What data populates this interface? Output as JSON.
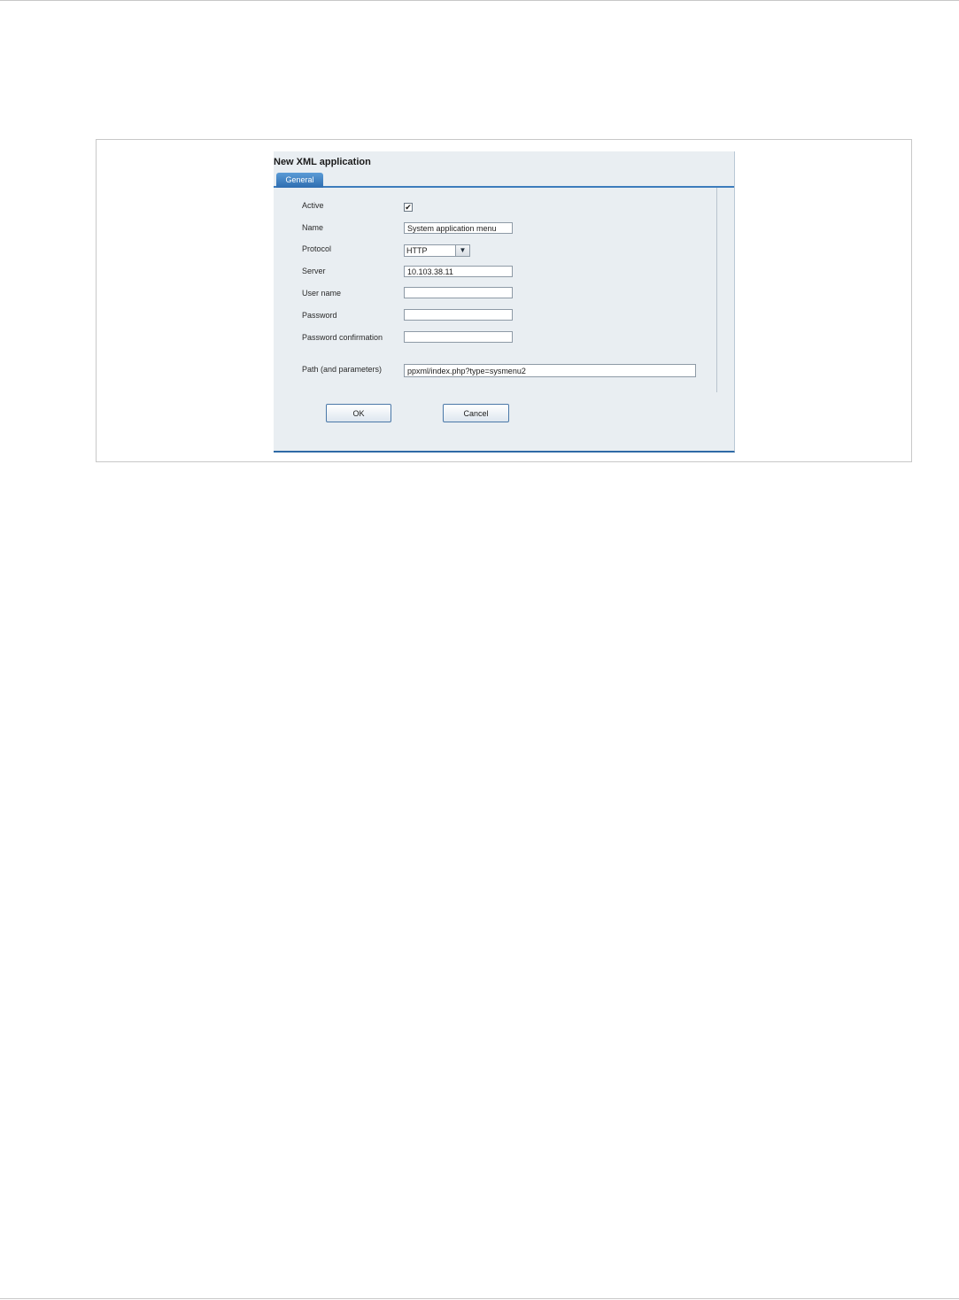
{
  "dialog": {
    "title": "New XML application",
    "tabs": [
      {
        "label": "General"
      }
    ]
  },
  "form": {
    "active": {
      "label": "Active",
      "checked": true,
      "check_glyph": "✔"
    },
    "name": {
      "label": "Name",
      "value": "System application menu"
    },
    "protocol": {
      "label": "Protocol",
      "selected": "HTTP",
      "arrow_icon": "▼"
    },
    "server": {
      "label": "Server",
      "value": "10.103.38.11"
    },
    "user_name": {
      "label": "User name",
      "value": ""
    },
    "password": {
      "label": "Password",
      "value": ""
    },
    "password_confirmation": {
      "label": "Password confirmation",
      "value": ""
    },
    "path": {
      "label": "Path (and parameters)",
      "value": "ppxml/index.php?type=sysmenu2"
    }
  },
  "buttons": {
    "ok_label": "OK",
    "cancel_label": "Cancel"
  },
  "colors": {
    "accent": "#2f6aa6",
    "dialog_bg": "#e9eef2"
  }
}
